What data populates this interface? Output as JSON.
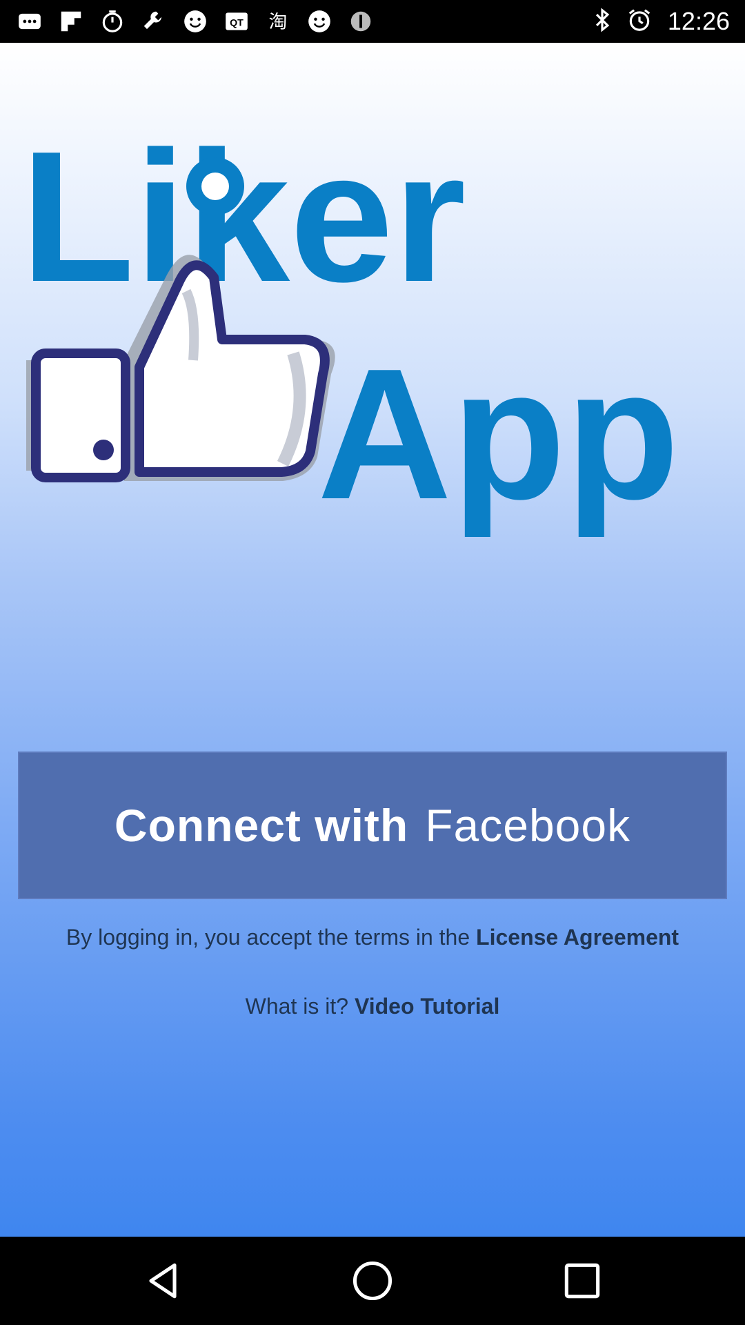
{
  "status_bar": {
    "time": "12:26",
    "left_icons": [
      "more-icon",
      "flipboard-icon",
      "timer-icon",
      "wrench-icon",
      "smiley-icon",
      "qq-icon",
      "taobao-icon",
      "smiley-icon",
      "info-icon"
    ],
    "right_icons": [
      "bluetooth-icon",
      "alarm-icon"
    ]
  },
  "logo": {
    "word1": "Liker",
    "word2": "App",
    "color": "#0a7fc6"
  },
  "connect_button": {
    "bold_text": "Connect with",
    "light_text": "Facebook",
    "color": "#506eaf"
  },
  "terms": {
    "prefix": "By logging in, you accept the terms in the ",
    "link": "License Agreement"
  },
  "tutorial": {
    "prefix": "What is it? ",
    "link": "Video Tutorial"
  },
  "nav_bar": {
    "buttons": [
      "back-icon",
      "home-icon",
      "recents-icon"
    ]
  }
}
